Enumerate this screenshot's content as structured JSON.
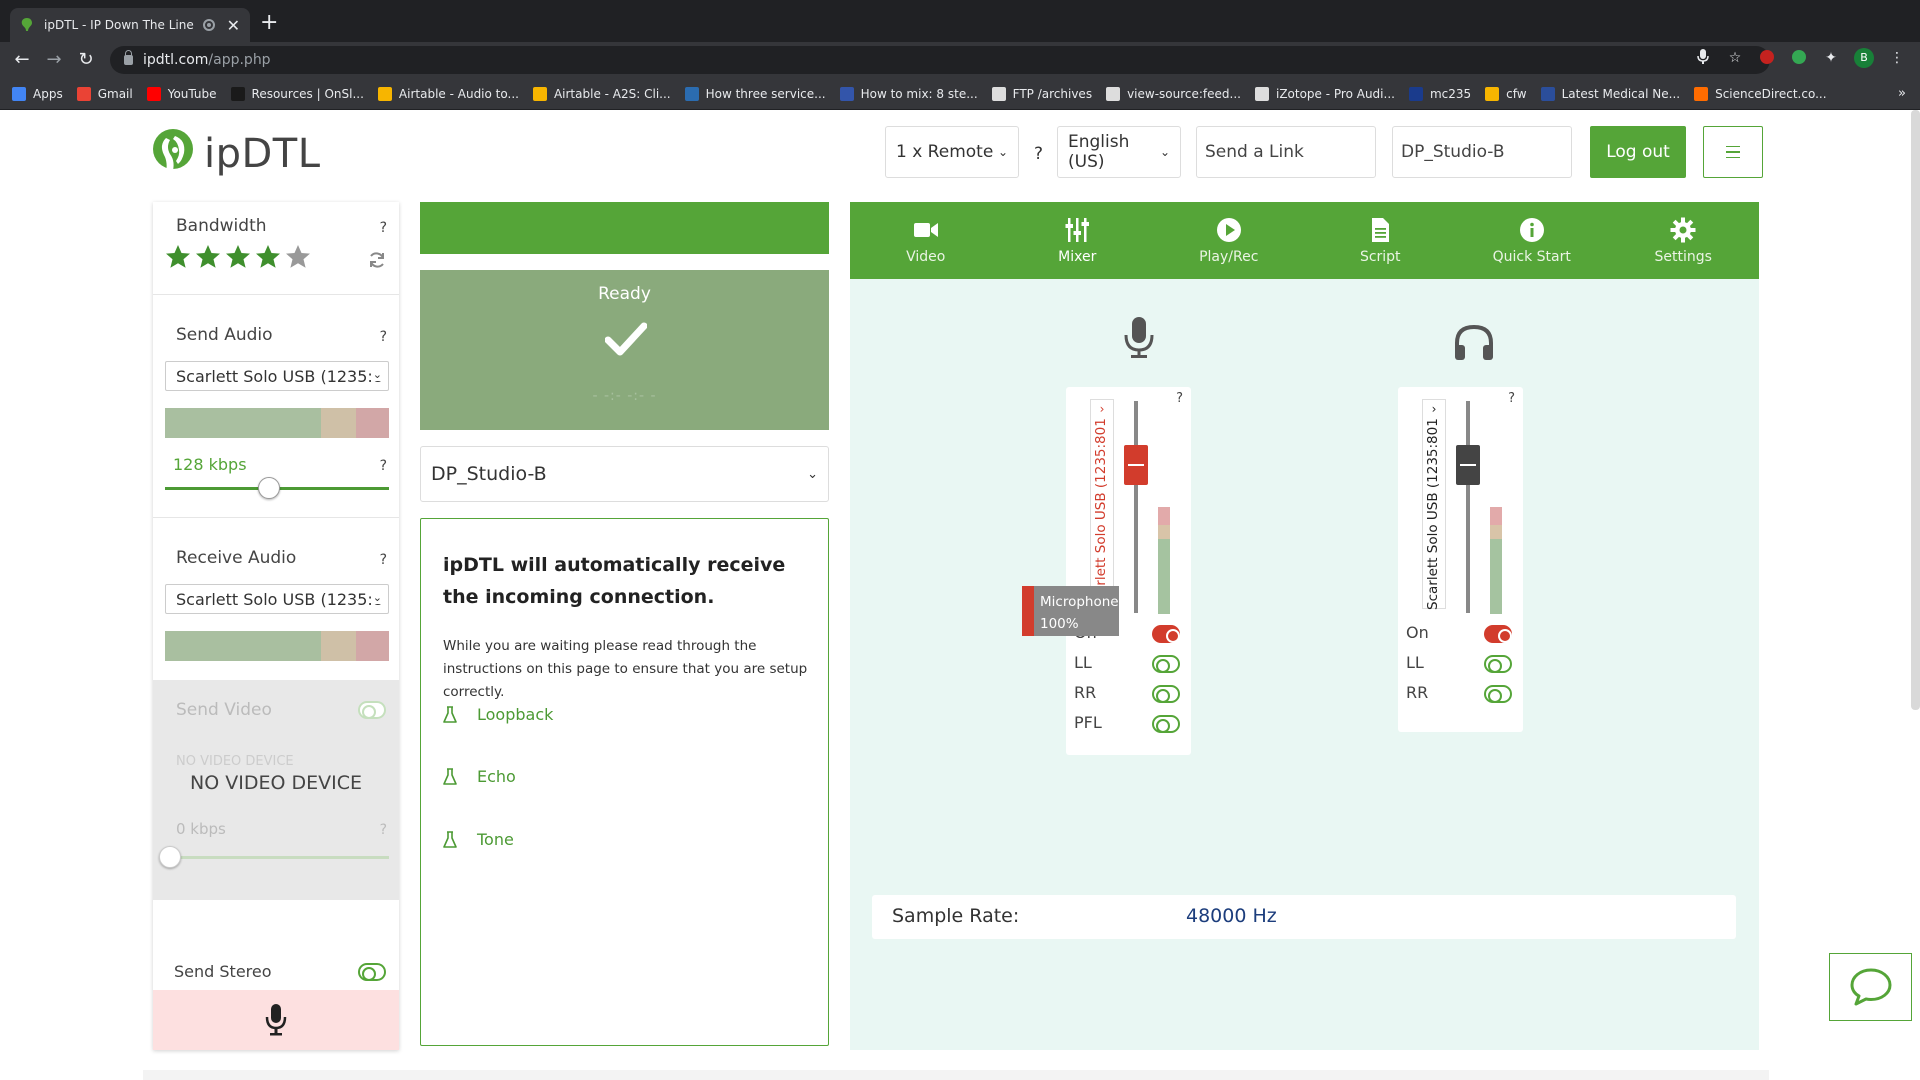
{
  "browser": {
    "tab_title": "ipDTL - IP Down The Line",
    "url_host": "ipdtl.com",
    "url_path": "/app.php",
    "profile_initial": "B",
    "bookmarks": [
      {
        "label": "Apps",
        "color": "#4285f4"
      },
      {
        "label": "Gmail",
        "color": "#ea4335"
      },
      {
        "label": "YouTube",
        "color": "#ff0000"
      },
      {
        "label": "Resources | OnSl...",
        "color": "#1a1a1a"
      },
      {
        "label": "Airtable - Audio to...",
        "color": "#f7b500"
      },
      {
        "label": "Airtable - A2S: Cli...",
        "color": "#f7b500"
      },
      {
        "label": "How three service...",
        "color": "#2b6cb0"
      },
      {
        "label": "How to mix: 8 ste...",
        "color": "#3355aa"
      },
      {
        "label": "FTP /archives",
        "color": "#dddddd"
      },
      {
        "label": "view-source:feed...",
        "color": "#dddddd"
      },
      {
        "label": "iZotope - Pro Audi...",
        "color": "#dddddd"
      },
      {
        "label": "mc235",
        "color": "#1a3b8c"
      },
      {
        "label": "cfw",
        "color": "#f7b500"
      },
      {
        "label": "Latest Medical Ne...",
        "color": "#2b4e9b"
      },
      {
        "label": "ScienceDirect.co...",
        "color": "#ff6c00"
      }
    ],
    "bookmarks_more": "»"
  },
  "header": {
    "logo_text": "ipDTL",
    "remote_select": "1 x Remote",
    "help": "?",
    "language_select": "English (US)",
    "send_link_placeholder": "Send a Link",
    "station_name": "DP_Studio-B",
    "logout_label": "Log out"
  },
  "left": {
    "bandwidth": {
      "title": "Bandwidth",
      "help": "?",
      "stars_filled": 4,
      "stars_total": 5
    },
    "send_audio": {
      "title": "Send Audio",
      "help": "?",
      "device": "Scarlett Solo USB (1235:8",
      "kbps": "128 kbps",
      "kbps_help": "?",
      "kbps_value": 128
    },
    "receive_audio": {
      "title": "Receive Audio",
      "help": "?",
      "device": "Scarlett Solo USB (1235:8"
    },
    "send_video": {
      "title": "Send Video",
      "device_small": "NO VIDEO DEVICE",
      "device_big": "NO VIDEO DEVICE",
      "kbps": "0 kbps",
      "kbps_help": "?"
    },
    "send_stereo": {
      "title": "Send Stereo"
    }
  },
  "middle": {
    "status_label": "Ready",
    "status_timer": "- -:- -:- -",
    "remote_name": "DP_Studio-B",
    "info_title": "ipDTL will automatically receive the incoming connection.",
    "info_body": "While you are waiting please read through the instructions on this page to ensure that you are setup correctly.",
    "tests": [
      "Loopback",
      "Echo",
      "Tone"
    ]
  },
  "right": {
    "nav": [
      {
        "label": "Video",
        "icon": "video-camera-icon"
      },
      {
        "label": "Mixer",
        "icon": "mixer-sliders-icon"
      },
      {
        "label": "Play/Rec",
        "icon": "play-circle-icon"
      },
      {
        "label": "Script",
        "icon": "document-icon"
      },
      {
        "label": "Quick Start",
        "icon": "info-circle-icon"
      },
      {
        "label": "Settings",
        "icon": "gear-icon"
      }
    ],
    "mic_strip": {
      "device_label": "Scarlett Solo USB (1235:801",
      "help": "?",
      "tooltip_name": "Microphone",
      "tooltip_level": "100%",
      "toggles": [
        {
          "label": "On",
          "state": "on"
        },
        {
          "label": "LL",
          "state": "off"
        },
        {
          "label": "RR",
          "state": "off"
        },
        {
          "label": "PFL",
          "state": "off"
        }
      ]
    },
    "headphone_strip": {
      "device_label": "Scarlett Solo USB (1235:801",
      "help": "?",
      "toggles": [
        {
          "label": "On",
          "state": "on"
        },
        {
          "label": "LL",
          "state": "off"
        },
        {
          "label": "RR",
          "state": "off"
        }
      ]
    },
    "sample_rate_label": "Sample Rate:",
    "sample_rate_value": "48000 Hz"
  },
  "colors": {
    "brand_green": "#55a538",
    "ready_green": "#8aaa7c",
    "mixer_bg": "#e9f7f3",
    "active_red": "#d23c2c"
  }
}
